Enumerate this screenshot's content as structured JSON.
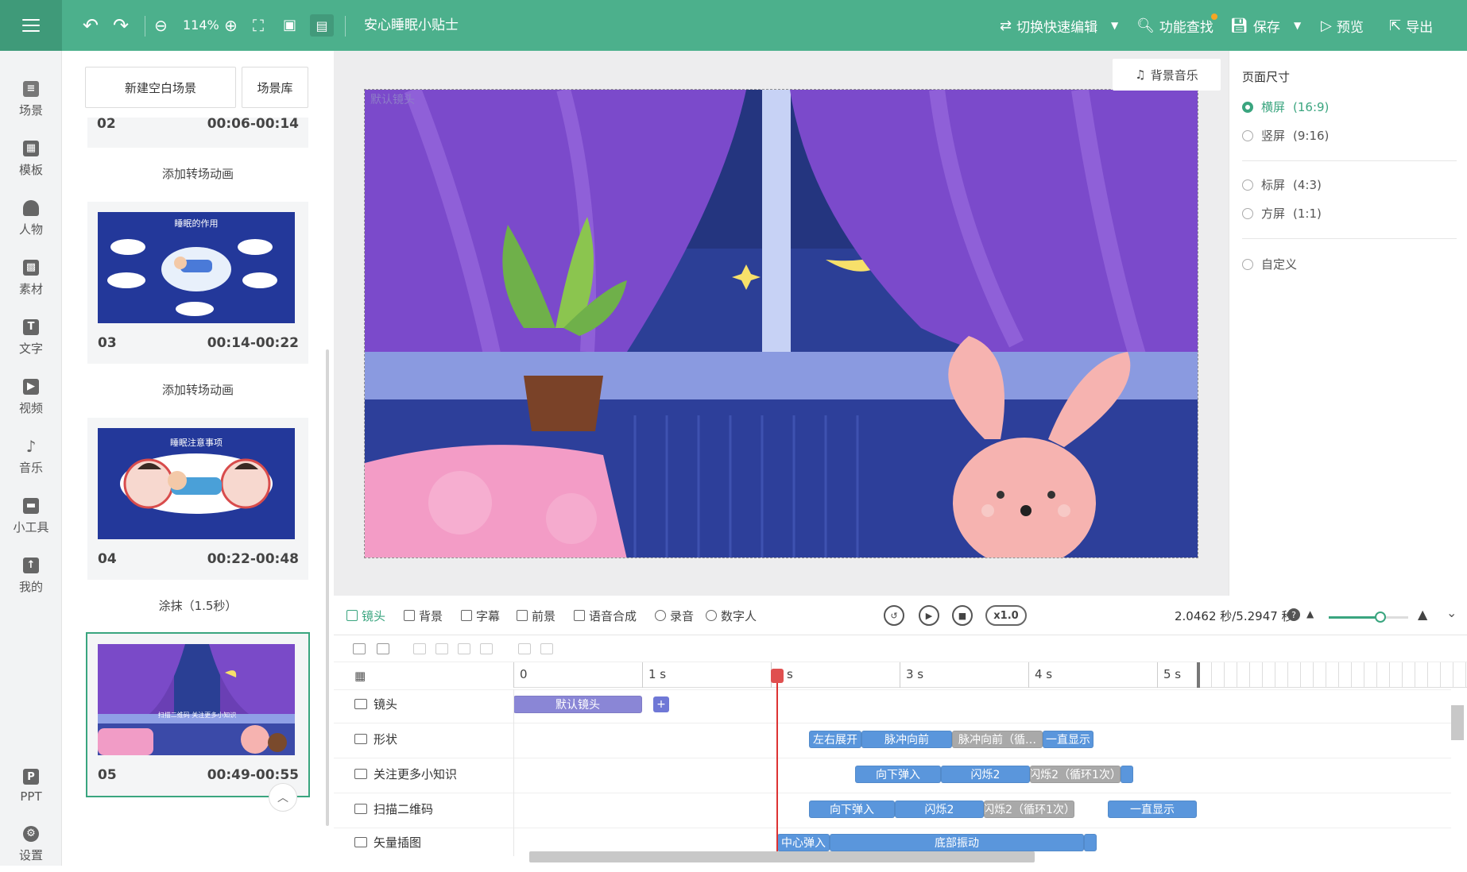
{
  "topbar": {
    "zoom": "114%",
    "project_title": "安心睡眠小贴士",
    "switch_edit": "切换快速编辑",
    "feature_search": "功能查找",
    "save": "保存",
    "preview": "预览",
    "export": "导出",
    "accent": "#4cb08c"
  },
  "nav": [
    {
      "label": "场景",
      "icon": "scene-icon"
    },
    {
      "label": "模板",
      "icon": "template-icon"
    },
    {
      "label": "人物",
      "icon": "person-icon"
    },
    {
      "label": "素材",
      "icon": "material-icon"
    },
    {
      "label": "文字",
      "icon": "text-icon"
    },
    {
      "label": "视频",
      "icon": "video-icon"
    },
    {
      "label": "音乐",
      "icon": "music-icon"
    },
    {
      "label": "小工具",
      "icon": "toolbox-icon"
    },
    {
      "label": "我的",
      "icon": "my-icon"
    },
    {
      "label": "PPT",
      "icon": "ppt-icon"
    },
    {
      "label": "设置",
      "icon": "settings-icon"
    }
  ],
  "scenes": {
    "new_blank": "新建空白场景",
    "library": "场景库",
    "partial": {
      "num": "02",
      "time": "00:06-00:14"
    },
    "items": [
      {
        "num": "03",
        "time": "00:14-00:22",
        "thumb_title": "睡眠的作用"
      },
      {
        "num": "04",
        "time": "00:22-00:48",
        "thumb_title": "睡眠注意事项"
      },
      {
        "num": "05",
        "time": "00:49-00:55",
        "thumb_title": "扫描二维码 关注更多小知识"
      }
    ],
    "transitions": [
      "添加转场动画",
      "添加转场动画",
      "涂抹（1.5秒）"
    ]
  },
  "canvas": {
    "bg_music": "背景音乐",
    "default_lens": "默认镜头"
  },
  "page_size": {
    "title": "页面尺寸",
    "options": [
      {
        "label": "横屏",
        "ratio": "(16:9)",
        "selected": true
      },
      {
        "label": "竖屏",
        "ratio": "(9:16)",
        "selected": false
      },
      {
        "label": "标屏",
        "ratio": "(4:3)",
        "selected": false
      },
      {
        "label": "方屏",
        "ratio": "(1:1)",
        "selected": false
      },
      {
        "label": "自定义",
        "ratio": "",
        "selected": false
      }
    ]
  },
  "timeline": {
    "tabs": [
      "镜头",
      "背景",
      "字幕",
      "前景",
      "语音合成",
      "录音",
      "数字人"
    ],
    "speed": "x1.0",
    "time_readout": "2.0462 秒/5.2947 秒",
    "ruler": [
      "0",
      "1 s",
      "s",
      "3 s",
      "4 s",
      "5 s"
    ],
    "playhead_seconds": 2.0462,
    "zoom_level": 0.64,
    "rows": [
      {
        "label": "镜头",
        "clips": [
          "默认镜头"
        ]
      },
      {
        "label": "形状",
        "clips": [
          "左右展开",
          "脉冲向前",
          "脉冲向前（循…",
          "一直显示"
        ]
      },
      {
        "label": "关注更多小知识",
        "clips": [
          "向下弹入",
          "闪烁2",
          "闪烁2（循环1次）"
        ]
      },
      {
        "label": "扫描二维码",
        "clips": [
          "向下弹入",
          "闪烁2",
          "闪烁2（循环1次）",
          "一直显示"
        ]
      },
      {
        "label": "矢量插图",
        "clips": [
          "中心弹入",
          "底部振动"
        ]
      }
    ]
  }
}
